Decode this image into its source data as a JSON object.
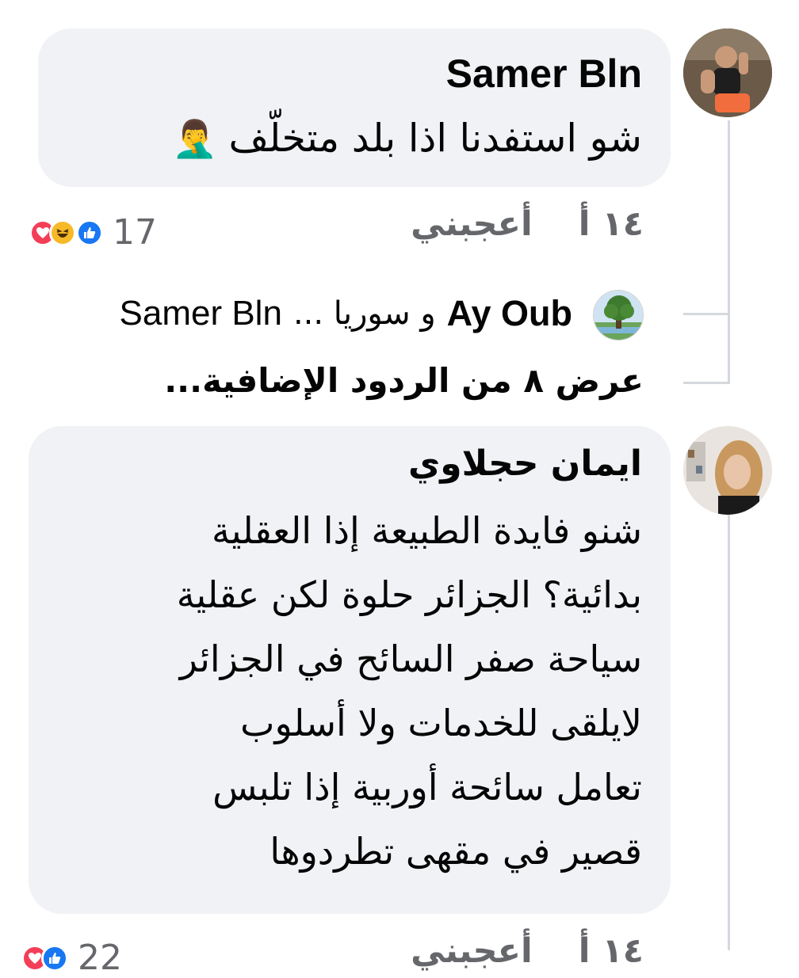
{
  "comments": [
    {
      "author": "Samer Bln",
      "text": "شو استفدنا اذا بلد متخلّف",
      "emoji": "🤦‍♂️",
      "time": "١٤ أ",
      "like_label": "أعجبني",
      "reaction_count": "17",
      "reactions": [
        "like",
        "haha",
        "love"
      ],
      "replies": {
        "author": "Ay Oub",
        "text": "و سوريا ...",
        "mention": "Samer Bln",
        "more": "عرض ٨ من الردود الإضافية..."
      }
    },
    {
      "author": "ايمان حجلاوي",
      "text": "شنو فايدة الطبيعة إذا العقلية\nبدائية؟ الجزائر حلوة لكن عقلية\nسياحة صفر السائح في الجزائر\nلايلقى للخدمات ولا أسلوب\nتعامل سائحة أوربية إذا تلبس\nقصير في مقهى تطردوها",
      "time": "١٤ أ",
      "like_label": "أعجبني",
      "reaction_count": "22",
      "reactions": [
        "like",
        "love"
      ]
    }
  ],
  "colors": {
    "bubble": "#f0f2f5",
    "meta_text": "#65676b",
    "like_blue": "#1877f2",
    "haha_yellow": "#f7b928",
    "love_red": "#f33e58"
  }
}
